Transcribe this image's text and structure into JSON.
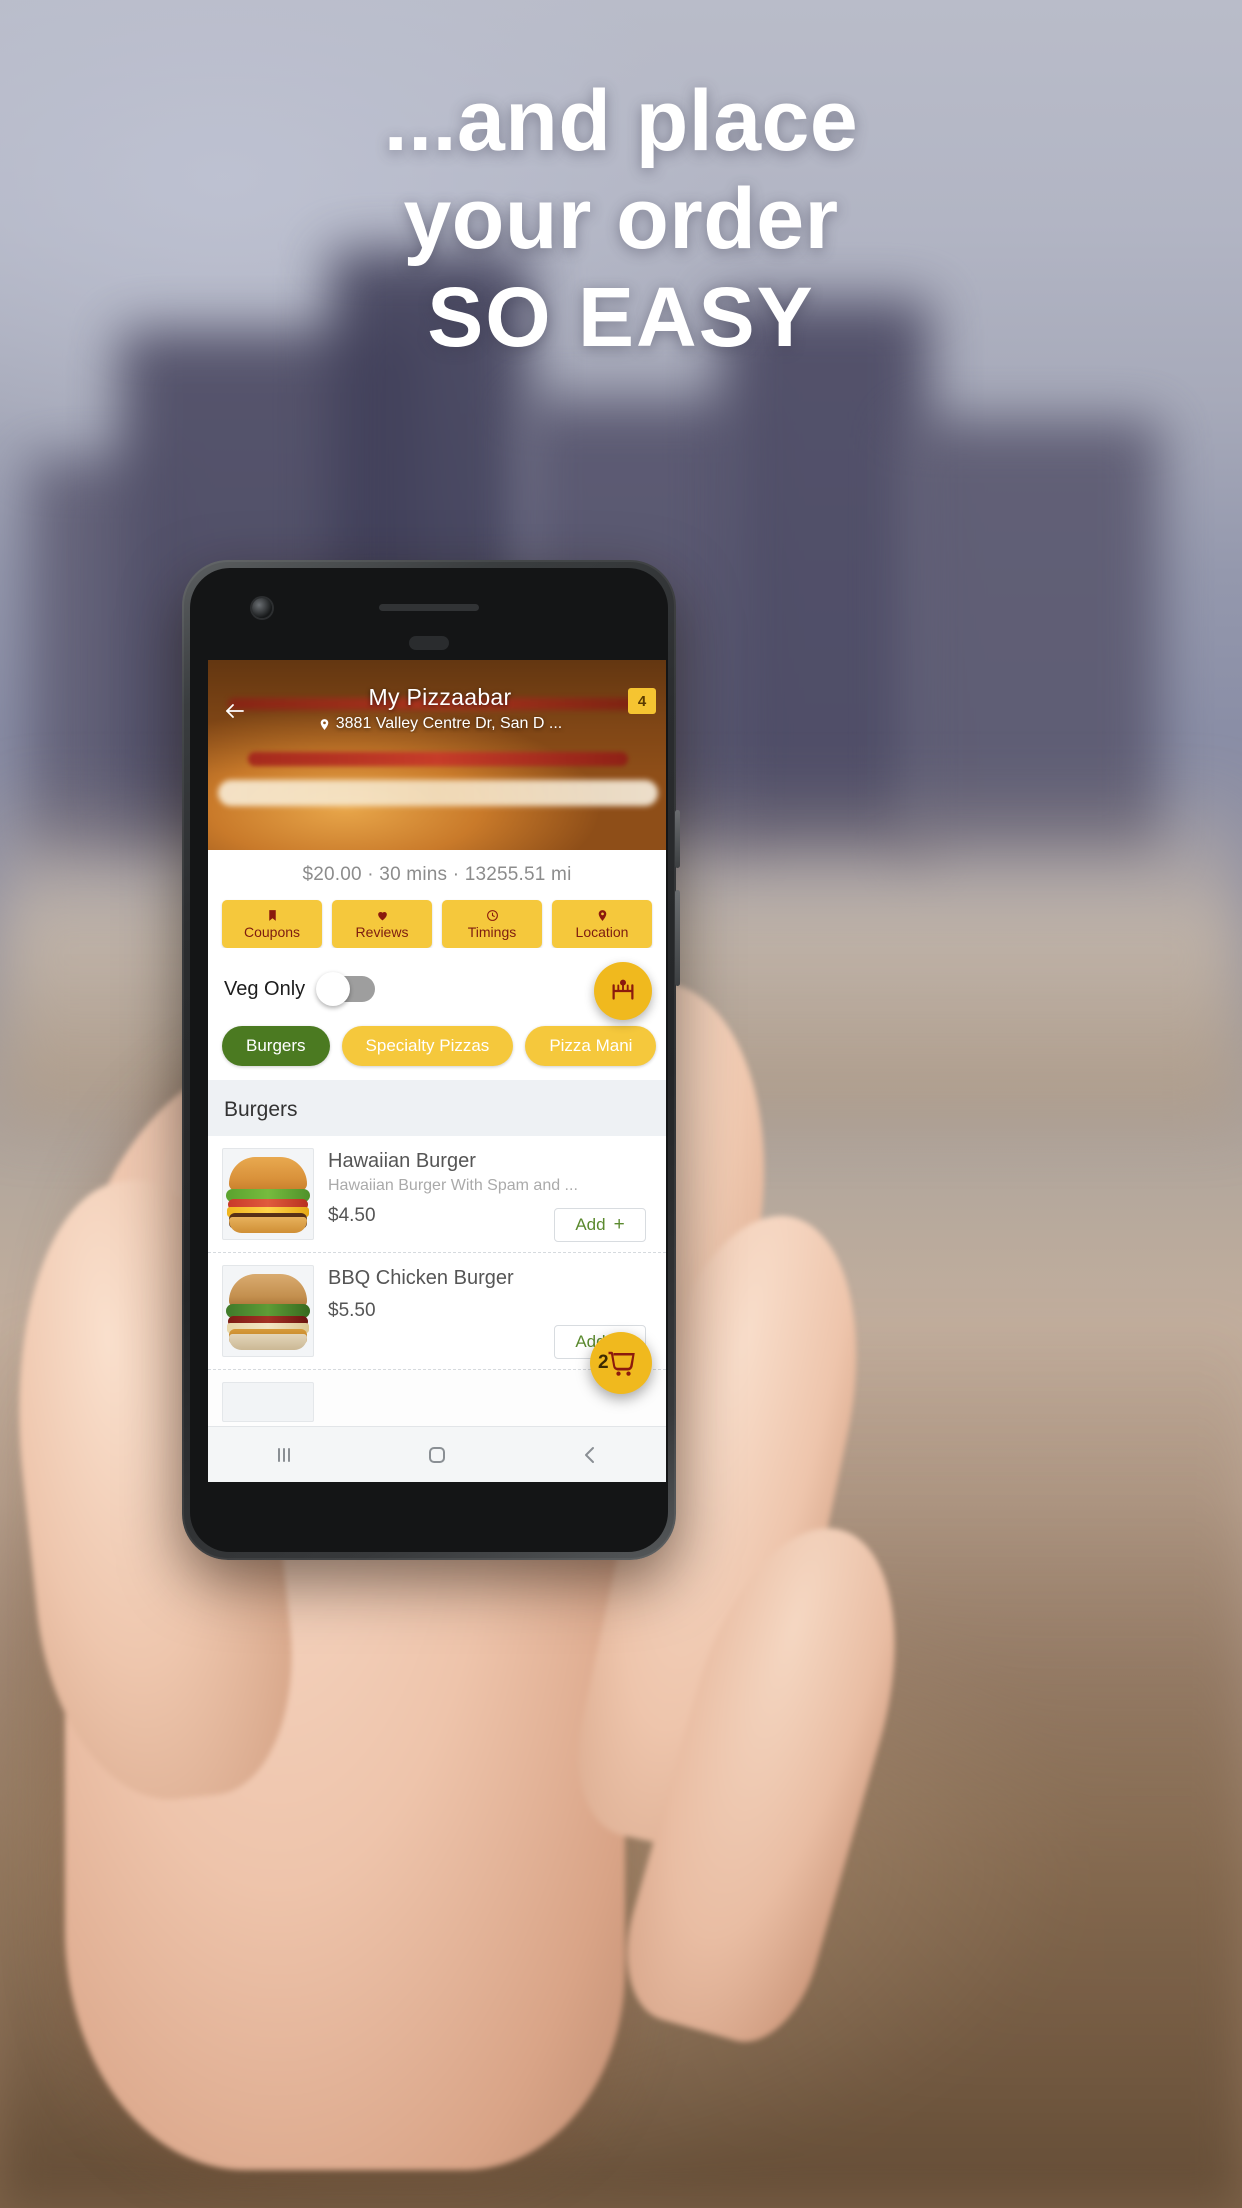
{
  "promo": {
    "line1": "...and place",
    "line2": "your order",
    "line3": "SO EASY"
  },
  "app": {
    "header": {
      "back_icon": "arrow-left-icon",
      "restaurant_name": "My Pizzaabar",
      "location_icon": "map-pin-icon",
      "address": "3881 Valley Centre Dr, San D ...",
      "cart_badge_count": "4"
    },
    "meta": {
      "min_order": "$20.00",
      "separator1": "·",
      "delivery_time": "30 mins",
      "separator2": "·",
      "distance": "13255.51 mi",
      "summary": "$20.00 · 30 mins · 13255.51 mi"
    },
    "action_chips": [
      {
        "label": "Coupons",
        "icon": "bookmark-icon"
      },
      {
        "label": "Reviews",
        "icon": "heart-icon"
      },
      {
        "label": "Timings",
        "icon": "clock-icon"
      },
      {
        "label": "Location",
        "icon": "map-pin-icon"
      }
    ],
    "veg_filter": {
      "label": "Veg Only",
      "enabled": false
    },
    "filter_fab": {
      "icon": "food-filter-icon"
    },
    "categories": [
      {
        "label": "Burgers",
        "active": true
      },
      {
        "label": "Specialty Pizzas",
        "active": false
      },
      {
        "label": "Pizza Mani",
        "active": false
      }
    ],
    "menu_section_title": "Burgers",
    "menu_items": [
      {
        "name": "Hawaiian Burger",
        "description": "Hawaiian Burger With Spam and ...",
        "price": "$4.50",
        "add_label": "Add",
        "add_plus": "+",
        "image": "hawaiian-burger-thumbnail"
      },
      {
        "name": "BBQ Chicken Burger",
        "description": "",
        "price": "$5.50",
        "add_label": "Add",
        "add_plus": "+",
        "image": "bbq-chicken-burger-thumbnail"
      }
    ],
    "cart_fab": {
      "count": "2",
      "icon": "shopping-cart-icon"
    },
    "navbar": [
      {
        "icon": "recents-icon"
      },
      {
        "icon": "home-icon"
      },
      {
        "icon": "back-icon"
      }
    ]
  },
  "colors": {
    "accent_yellow": "#f5c83c",
    "fab_yellow": "#f0b91e",
    "active_green": "#4b7a21",
    "add_green": "#5b8a2f",
    "chip_text": "#7d1c10"
  }
}
